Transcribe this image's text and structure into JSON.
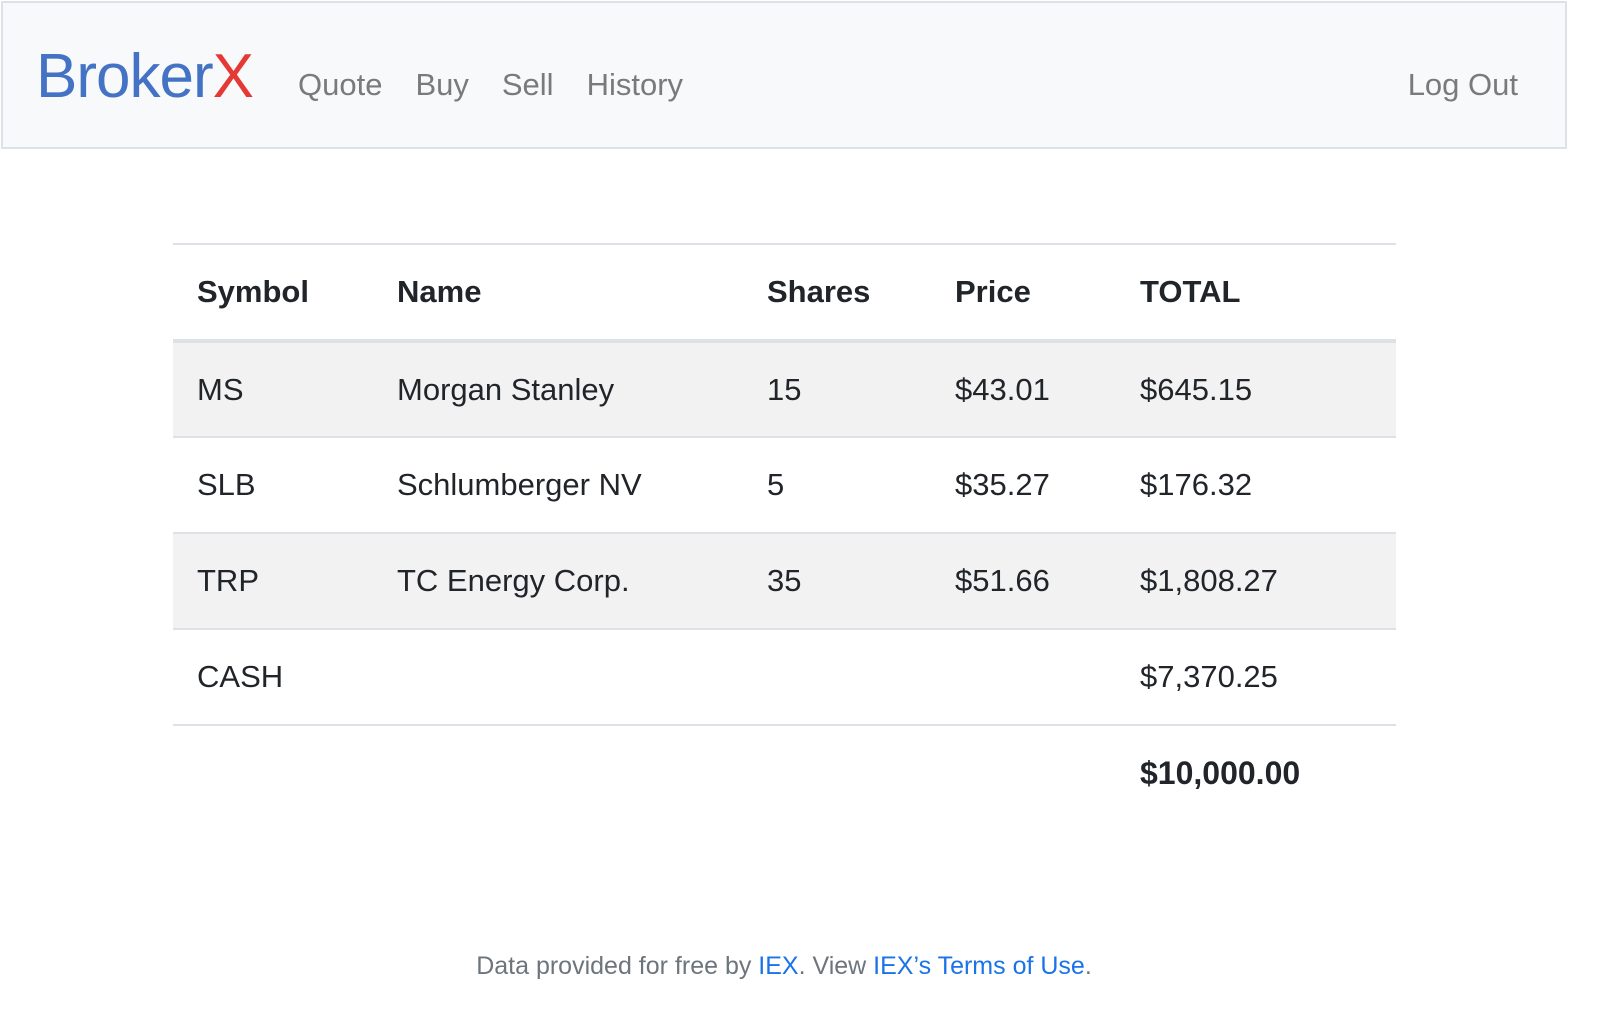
{
  "navbar": {
    "brand_main": "Broker",
    "brand_accent": "X",
    "links": [
      {
        "label": "Quote"
      },
      {
        "label": "Buy"
      },
      {
        "label": "Sell"
      },
      {
        "label": "History"
      }
    ],
    "logout_label": "Log Out"
  },
  "table": {
    "headers": {
      "symbol": "Symbol",
      "name": "Name",
      "shares": "Shares",
      "price": "Price",
      "total": "TOTAL"
    },
    "rows": [
      {
        "symbol": "MS",
        "name": "Morgan Stanley",
        "shares": "15",
        "price": "$43.01",
        "total": "$645.15"
      },
      {
        "symbol": "SLB",
        "name": "Schlumberger NV",
        "shares": "5",
        "price": "$35.27",
        "total": "$176.32"
      },
      {
        "symbol": "TRP",
        "name": "TC Energy Corp.",
        "shares": "35",
        "price": "$51.66",
        "total": "$1,808.27"
      }
    ],
    "cash": {
      "label": "CASH",
      "total": "$7,370.25"
    },
    "grand_total": "$10,000.00"
  },
  "footer": {
    "prefix": "Data provided for free by ",
    "iex_link": "IEX",
    "middle": ". View ",
    "terms_link": "IEX’s Terms of Use",
    "suffix": "."
  },
  "colors": {
    "brand_blue": "#4472c4",
    "brand_red": "#e53935",
    "link_blue": "#1a73e8",
    "navbar_bg": "#f8f9fa",
    "stripe_bg": "#f2f2f2"
  }
}
